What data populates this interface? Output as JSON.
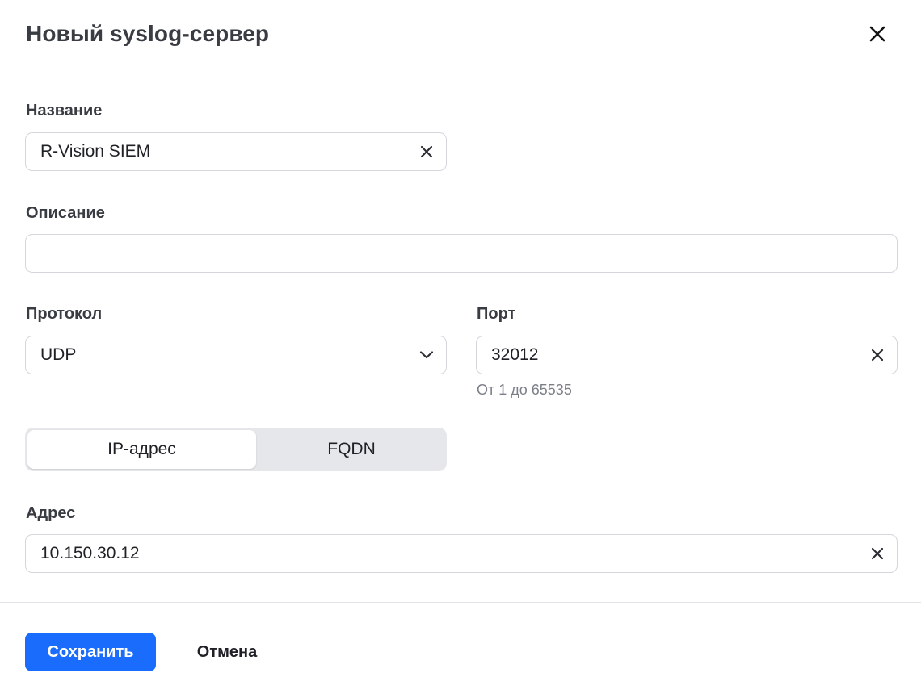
{
  "dialog": {
    "title": "Новый syslog-сервер",
    "close_icon": "close-icon"
  },
  "form": {
    "name": {
      "label": "Название",
      "value": "R-Vision SIEM"
    },
    "description": {
      "label": "Описание",
      "value": ""
    },
    "protocol": {
      "label": "Протокол",
      "selected": "UDP"
    },
    "port": {
      "label": "Порт",
      "value": "32012",
      "hint": "От 1 до 65535"
    },
    "address_type": {
      "options": [
        "IP-адрес",
        "FQDN"
      ],
      "selected": "IP-адрес"
    },
    "address": {
      "label": "Адрес",
      "value": "10.150.30.12"
    }
  },
  "footer": {
    "save_label": "Сохранить",
    "cancel_label": "Отмена"
  },
  "colors": {
    "primary": "#1a6dfc",
    "border": "#d4d6dc",
    "segment_bg": "#e6e7ea",
    "hint_text": "#7c7f88"
  }
}
